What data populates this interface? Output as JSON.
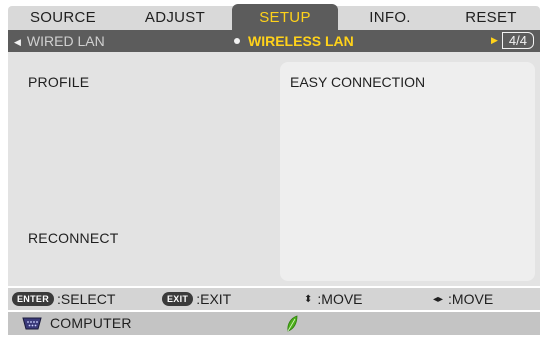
{
  "tabs": [
    {
      "label": "SOURCE"
    },
    {
      "label": "ADJUST"
    },
    {
      "label": "SETUP"
    },
    {
      "label": "INFO."
    },
    {
      "label": "RESET"
    }
  ],
  "active_tab": "SETUP",
  "subpage": {
    "prev": "WIRED LAN",
    "current": "WIRELESS LAN",
    "page_indicator": "4/4"
  },
  "settings": {
    "profile_label": "PROFILE",
    "profile_value": "EASY CONNECTION",
    "reconnect_label": "RECONNECT"
  },
  "hints": {
    "enter_key": "ENTER",
    "enter_action": ":SELECT",
    "exit_key": "EXIT",
    "exit_action": ":EXIT",
    "updown_action": ":MOVE",
    "leftright_action": ":MOVE"
  },
  "status": {
    "source": "COMPUTER",
    "source_icon": "computer-connector-icon",
    "eco_icon": "eco-leaf-icon"
  },
  "colors": {
    "active_tab_text": "#ffd21a",
    "active_bg": "#5c5c5c",
    "eco_leaf": "#4caf1a"
  }
}
